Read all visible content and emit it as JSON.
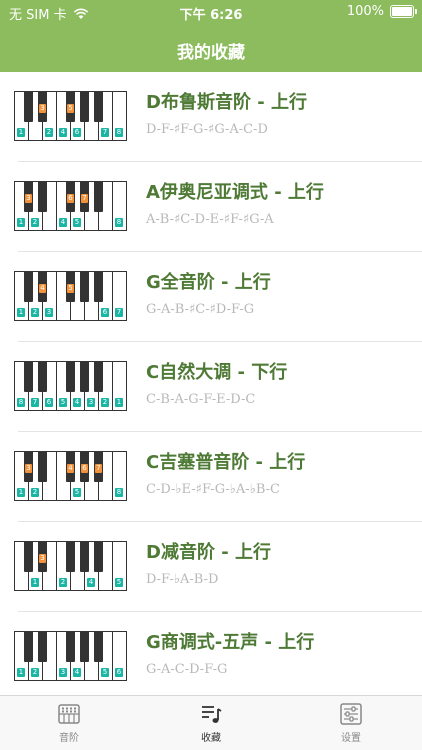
{
  "status_bar": {
    "carrier": "无 SIM 卡",
    "time": "下午 6:26",
    "battery": "100%"
  },
  "nav": {
    "title": "我的收藏"
  },
  "favorites": [
    {
      "name": "D布鲁斯音阶 - 上行",
      "notes": "D-F-♯F-G-♯G-A-C-D",
      "white_labels": [
        "1",
        "",
        "2",
        "4",
        "6",
        "",
        "7",
        "8"
      ],
      "black_labels": [
        "",
        "3",
        "5",
        "",
        ""
      ]
    },
    {
      "name": "A伊奥尼亚调式 - 上行",
      "notes": "A-B-♯C-D-E-♯F-♯G-A",
      "white_labels": [
        "1",
        "2",
        "",
        "4",
        "5",
        "",
        "",
        "8"
      ],
      "black_labels": [
        "3",
        "",
        "6",
        "7",
        ""
      ]
    },
    {
      "name": "G全音阶 - 上行",
      "notes": "G-A-B-♯C-♯D-F-G",
      "white_labels": [
        "1",
        "2",
        "3",
        "",
        "",
        "",
        "6",
        "7"
      ],
      "black_labels": [
        "",
        "4",
        "5",
        "",
        ""
      ]
    },
    {
      "name": "C自然大调 - 下行",
      "notes": "C-B-A-G-F-E-D-C",
      "white_labels": [
        "8",
        "7",
        "6",
        "5",
        "4",
        "3",
        "2",
        "1"
      ],
      "black_labels": [
        "",
        "",
        "",
        "",
        ""
      ]
    },
    {
      "name": "C吉塞普音阶 - 上行",
      "notes": "C-D-♭E-♯F-G-♭A-♭B-C",
      "white_labels": [
        "1",
        "2",
        "",
        "",
        "5",
        "",
        "",
        "8"
      ],
      "black_labels": [
        "3",
        "",
        "4",
        "6",
        "7"
      ]
    },
    {
      "name": "D减音阶 - 上行",
      "notes": "D-F-♭A-B-D",
      "white_labels": [
        "",
        "1",
        "",
        "2",
        "",
        "4",
        "",
        "5"
      ],
      "black_labels": [
        "",
        "3",
        "",
        "",
        ""
      ]
    },
    {
      "name": "G商调式-五声 - 上行",
      "notes": "G-A-C-D-F-G",
      "white_labels": [
        "1",
        "2",
        "",
        "3",
        "4",
        "",
        "5",
        "6"
      ],
      "black_labels": [
        "",
        "",
        "",
        "",
        ""
      ]
    }
  ],
  "tabbar": {
    "items": [
      {
        "label": "音阶"
      },
      {
        "label": "收藏"
      },
      {
        "label": "设置"
      }
    ]
  }
}
